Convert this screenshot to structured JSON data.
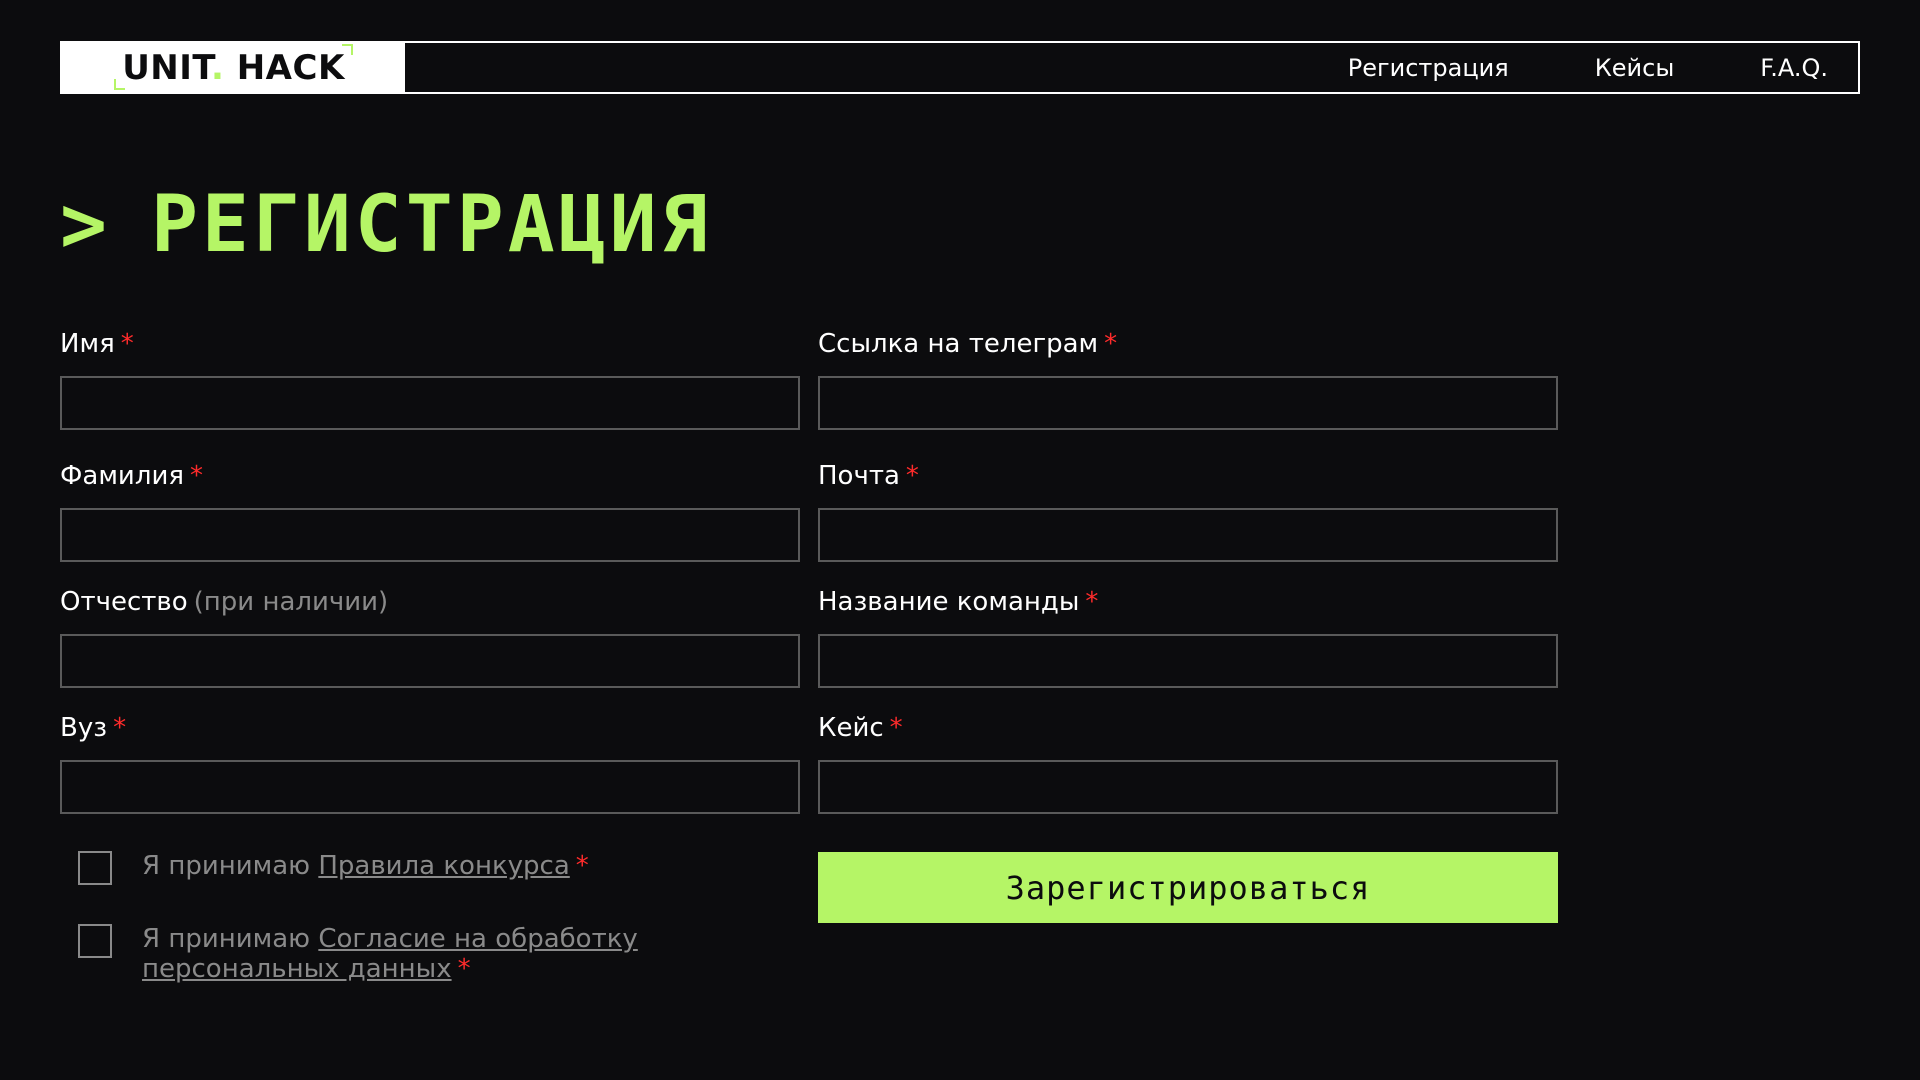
{
  "header": {
    "logo_left": "UNIT",
    "logo_dot": ".",
    "logo_right": "HACK",
    "nav": [
      "Регистрация",
      "Кейсы",
      "F.A.Q."
    ]
  },
  "page": {
    "chevron": ">",
    "title": "Регистрация"
  },
  "form": {
    "required_mark": "*",
    "fields": {
      "first_name": {
        "label": "Имя",
        "value": ""
      },
      "last_name": {
        "label": "Фамилия",
        "value": ""
      },
      "patronymic": {
        "label": "Отчество",
        "hint": "(при наличии)",
        "value": ""
      },
      "university": {
        "label": "Вуз",
        "value": ""
      },
      "telegram": {
        "label": "Ссылка на телеграм",
        "value": ""
      },
      "email": {
        "label": "Почта",
        "value": ""
      },
      "team_name": {
        "label": "Название команды",
        "value": ""
      },
      "case": {
        "label": "Кейс",
        "value": ""
      }
    },
    "checkboxes": {
      "rules": {
        "prefix": "Я принимаю",
        "link": "Правила конкурса",
        "checked": false
      },
      "consent": {
        "prefix": "Я принимаю",
        "link": "Согласие на обработку персональных данных",
        "checked": false
      }
    },
    "submit_label": "Зарегистрироваться"
  },
  "colors": {
    "accent": "#b5f566",
    "background": "#0c0c0e",
    "required": "#ff2b2b",
    "muted": "#8a8a8a"
  }
}
